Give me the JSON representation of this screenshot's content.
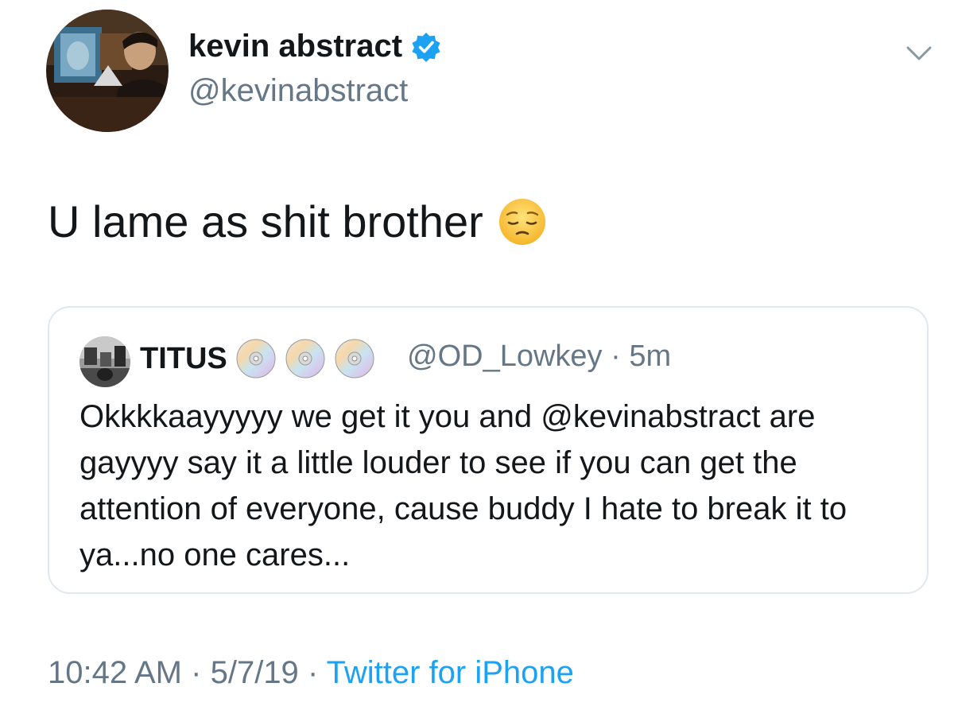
{
  "tweet": {
    "author": {
      "name": "kevin abstract",
      "handle": "@kevinabstract",
      "verified": true
    },
    "text": "U lame as shit brother",
    "emoji": "pensive-face",
    "quoted": {
      "name": "TITUS",
      "handle": "@OD_Lowkey",
      "separator": "·",
      "age": "5m",
      "badges": [
        "cd-icon",
        "cd-icon",
        "cd-icon"
      ],
      "text": "Okkkkaayyyyy we get it you and @kevinabstract are gayyyy say it a little louder to see if you can get the attention of everyone, cause buddy I hate to break it to ya...no one cares..."
    },
    "meta": {
      "time": "10:42 AM",
      "date": "5/7/19",
      "separator": "·",
      "source": "Twitter for iPhone"
    }
  },
  "colors": {
    "text": "#14171a",
    "secondary": "#657786",
    "link": "#1da1f2",
    "border": "#e1e8ed",
    "verified": "#1da1f2"
  }
}
